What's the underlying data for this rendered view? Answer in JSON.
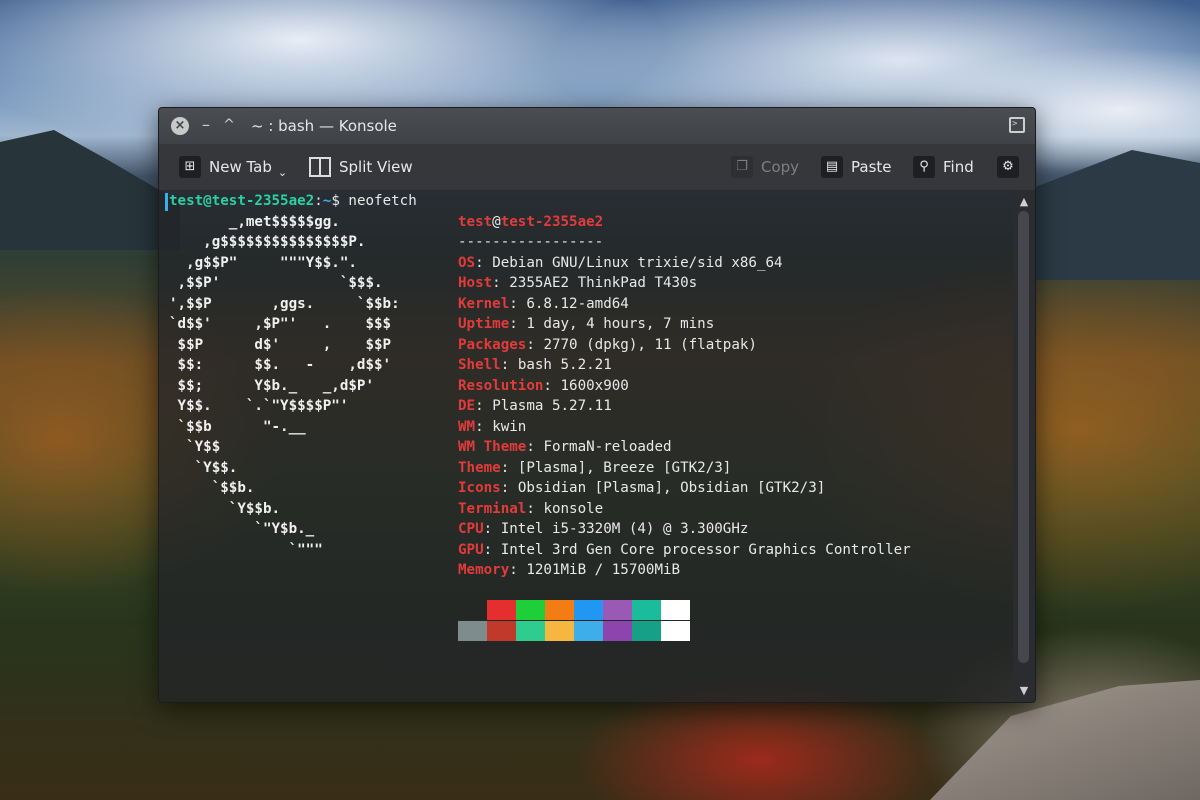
{
  "window": {
    "title": "~ : bash — Konsole",
    "close_glyph": "×",
    "minimize_glyph": "–",
    "maximize_glyph": "^"
  },
  "toolbar": {
    "new_tab": "New Tab",
    "split_view": "Split View",
    "copy": "Copy",
    "paste": "Paste",
    "find": "Find"
  },
  "icons": {
    "new_tab": "new-tab-icon",
    "split_view": "split-view-icon",
    "copy": "copy-icon",
    "paste": "paste-icon",
    "find": "search-icon",
    "settings": "gear-icon"
  },
  "terminal": {
    "prompt_user": "test@test-2355ae2",
    "prompt_sep": ":",
    "prompt_path": "~",
    "prompt_symbol": "$ ",
    "command": "neofetch",
    "ascii_lines": [
      "       _,met$$$$$gg.",
      "    ,g$$$$$$$$$$$$$$$P.",
      "  ,g$$P\"     \"\"\"Y$$.\".",
      " ,$$P'              `$$$.",
      "',$$P       ,ggs.     `$$b:",
      "`d$$'     ,$P\"'   .    $$$",
      " $$P      d$'     ,    $$P",
      " $$:      $$.   -    ,d$$'",
      " $$;      Y$b._   _,d$P'",
      " Y$$.    `.`\"Y$$$$P\"'",
      " `$$b      \"-.__",
      "  `Y$$",
      "   `Y$$.",
      "     `$$b.",
      "       `Y$$b.",
      "          `\"Y$b._",
      "              `\"\"\""
    ],
    "info_user": "test",
    "info_at": "@",
    "info_host": "test-2355ae2",
    "separator": "-----------------",
    "info": [
      {
        "label": "OS",
        "value": "Debian GNU/Linux trixie/sid x86_64"
      },
      {
        "label": "Host",
        "value": "2355AE2 ThinkPad T430s"
      },
      {
        "label": "Kernel",
        "value": "6.8.12-amd64"
      },
      {
        "label": "Uptime",
        "value": "1 day, 4 hours, 7 mins"
      },
      {
        "label": "Packages",
        "value": "2770 (dpkg), 11 (flatpak)"
      },
      {
        "label": "Shell",
        "value": "bash 5.2.21"
      },
      {
        "label": "Resolution",
        "value": "1600x900"
      },
      {
        "label": "DE",
        "value": "Plasma 5.27.11"
      },
      {
        "label": "WM",
        "value": "kwin"
      },
      {
        "label": "WM Theme",
        "value": "FormaN-reloaded"
      },
      {
        "label": "Theme",
        "value": "[Plasma], Breeze [GTK2/3]"
      },
      {
        "label": "Icons",
        "value": "Obsidian [Plasma], Obsidian [GTK2/3]"
      },
      {
        "label": "Terminal",
        "value": "konsole"
      },
      {
        "label": "CPU",
        "value": "Intel i5-3320M (4) @ 3.300GHz"
      },
      {
        "label": "GPU",
        "value": "Intel 3rd Gen Core processor Graphics Controller"
      },
      {
        "label": "Memory",
        "value": "1201MiB / 15700MiB"
      }
    ],
    "label_suffix": ": ",
    "palette_top": [
      "#e52e2e",
      "#1fcf3a",
      "#f47d13",
      "#2196f3",
      "#9b59b6",
      "#1abc9c",
      "#ffffff"
    ],
    "palette_bottom": [
      "#7f8c8d",
      "#c0392b",
      "#2ecc8f",
      "#f5b740",
      "#3daee9",
      "#8e44ad",
      "#16a085",
      "#ffffff"
    ]
  }
}
